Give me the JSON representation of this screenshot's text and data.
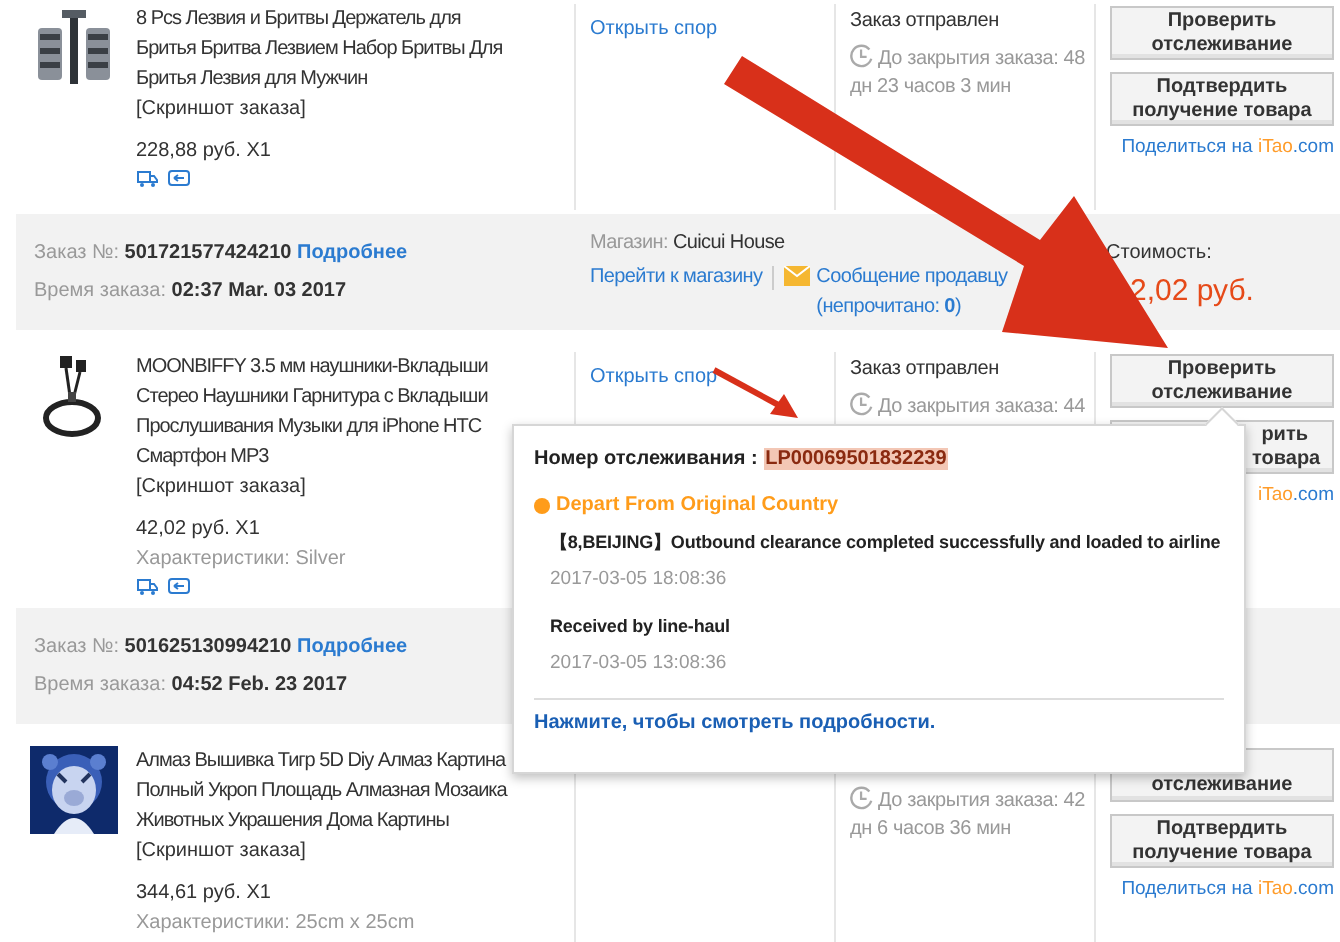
{
  "rows": [
    {
      "kind": "product",
      "title": "8 Pcs Лезвия и Бритвы Держатель для Бритья Бритва Лезвием Набор Бритвы Для Бритья Лезвия для Мужчин",
      "snapshot": "[Скриншот заказа]",
      "price": "228,88 руб. X1",
      "dispute": "Открыть спор",
      "status": "Заказ отправлен",
      "countdown": "До закрытия заказа: 48 дн 23 часов 3 мин",
      "buttons": [
        {
          "kind": "whole",
          "label": "Проверить отслеживание"
        },
        {
          "kind": "whole",
          "label": "Подтвердить получение товара"
        }
      ],
      "share": {
        "text": "Поделиться на",
        "brand": "iTao",
        "domain": ".com"
      }
    },
    {
      "kind": "order",
      "number_label": "Заказ №:",
      "number": "501721577424210",
      "details": "Подробнее",
      "time_label": "Время заказа:",
      "time": "02:37 Mar. 03 2017",
      "store_label": "Магазин:",
      "store": "Cuicui House",
      "store_link": "Перейти к магазину",
      "message": "Сообщение продавцу",
      "unread": "(непрочитано: **0**)",
      "cost_label": "Стоимость:",
      "cost": "2,02 руб."
    },
    {
      "kind": "product",
      "title": "MOONBIFFY 3.5 мм наушники-Вкладыши Стерео Наушники Гарнитура с Вкладыши Прослушивания Музыки для iPhone HTC Смартфон MP3",
      "snapshot": "[Скриншот заказа]",
      "price": "42,02 руб. X1",
      "specs": "Характеристики: Silver",
      "dispute": "Открыть спор",
      "status": "Заказ отправлен",
      "countdown": "До закрытия заказа: 44",
      "buttons": [
        {
          "kind": "whole",
          "label": "Проверить отслеживание"
        },
        {
          "kind": "right_part",
          "label": "рить товара"
        }
      ],
      "share": {
        "brand": "iTao",
        "domain": ".com"
      }
    },
    {
      "kind": "order",
      "number_label": "Заказ №:",
      "number": "501625130994210",
      "details": "Подробнее",
      "time_label": "Время заказа:",
      "time": "04:52 Feb. 23 2017"
    },
    {
      "kind": "product",
      "title": "Алмаз Вышивка Тигр 5D Diy Алмаз Картина Полный Укроп Площадь Алмазная Мозаика Животных Украшения Дома Картины",
      "snapshot": "[Скриншот заказа]",
      "price": "344,61 руб. X1",
      "specs": "Характеристики: 25cm x 25cm",
      "countdown": "До закрытия заказа: 42 дн 6 часов 36 мин",
      "buttons": [
        {
          "kind": "bottom_part",
          "label": "отслеживание"
        },
        {
          "kind": "whole",
          "label": "Подтвердить получение товара"
        }
      ],
      "share": {
        "text": "Поделиться на",
        "brand": "iTao",
        "domain": ".com"
      }
    }
  ],
  "tracking_popup": {
    "label": "Номер отслеживания :",
    "number": "LP00069501832239",
    "stage": "Depart From Original Country",
    "events": [
      {
        "text": "【8,BEIJING】Outbound clearance completed successfully and loaded to airline",
        "time": "2017-03-05 18:08:36"
      },
      {
        "text": "Received by line-haul",
        "time": "2017-03-05 13:08:36"
      }
    ],
    "link": "Нажмите, чтобы смотреть подробности."
  }
}
